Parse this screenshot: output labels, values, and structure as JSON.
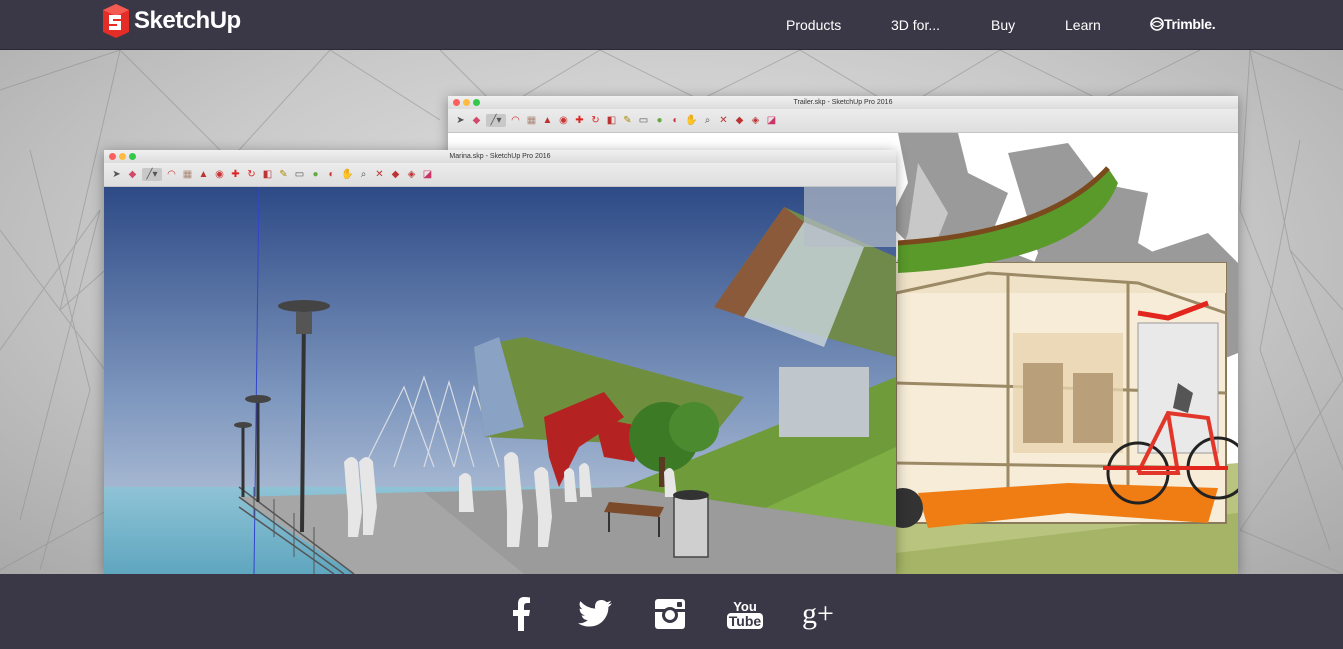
{
  "header": {
    "brand": "SketchUp",
    "nav": [
      "Products",
      "3D for...",
      "Buy",
      "Learn"
    ],
    "partner": "Trimble."
  },
  "hero": {
    "back_window": {
      "title": "Trailer.skp - SketchUp Pro 2016"
    },
    "front_window": {
      "title": "Marina.skp - SketchUp Pro 2016"
    }
  },
  "footer": {
    "social": [
      "facebook-icon",
      "twitter-icon",
      "instagram-icon",
      "youtube-icon",
      "google-plus-icon"
    ],
    "youtube_top": "You",
    "youtube_bottom": "Tube",
    "gplus_label": "g+"
  },
  "colors": {
    "bar_bg": "#3a3847",
    "logo_red": "#e52d27"
  }
}
